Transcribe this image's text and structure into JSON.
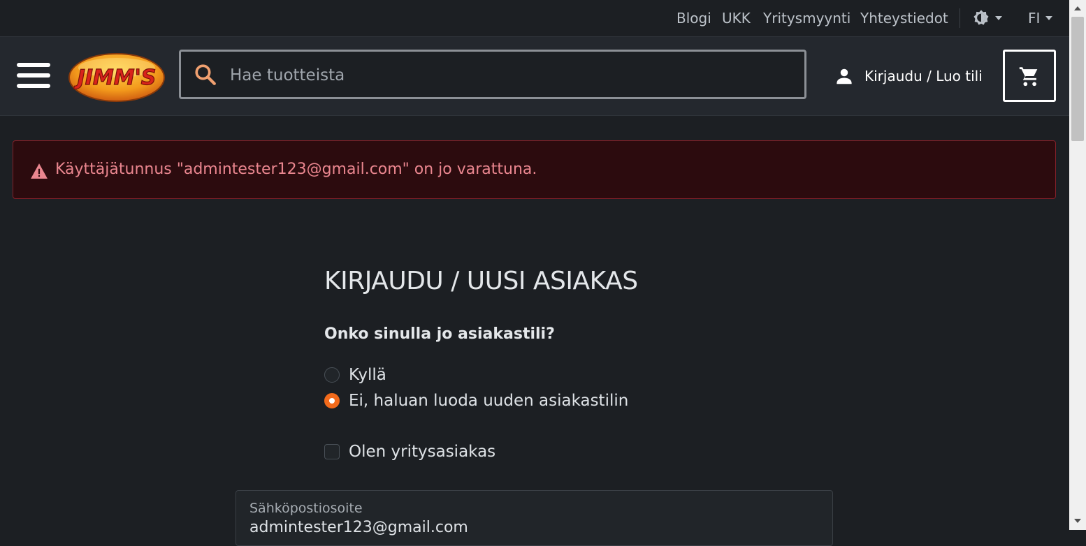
{
  "topbar": {
    "links": [
      "Blogi",
      "UKK",
      "Yritysmyynti",
      "Yhteystiedot"
    ],
    "language": "FI"
  },
  "header": {
    "logo_text": "JIMM'S",
    "search_placeholder": "Hae tuotteista",
    "account_label": "Kirjaudu / Luo tili"
  },
  "alert": {
    "message": "Käyttäjätunnus \"admintester123@gmail.com\" on jo varattuna."
  },
  "form": {
    "title": "KIRJAUDU / UUSI ASIAKAS",
    "question": "Onko sinulla jo asiakastili?",
    "options": [
      {
        "label": "Kyllä",
        "checked": false
      },
      {
        "label": "Ei, haluan luoda uuden asiakastilin",
        "checked": true
      }
    ],
    "business_label": "Olen yritysasiakas",
    "business_checked": false,
    "email_label": "Sähköpostiosoite",
    "email_value": "admintester123@gmail.com"
  },
  "colors": {
    "accent": "#f26a1b",
    "alert_text": "#ea868f",
    "alert_bg": "#2c0b0e"
  }
}
